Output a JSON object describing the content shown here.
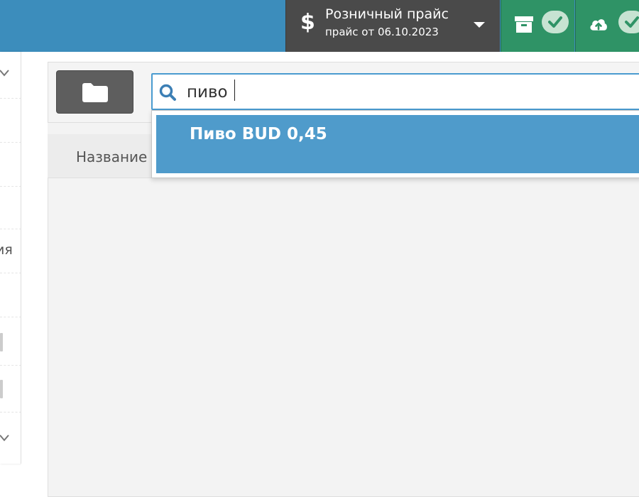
{
  "header": {
    "price_list": {
      "currency_symbol": "$",
      "title": "Розничный прайс",
      "subtitle": "прайс от 06.10.2023",
      "icon": "chevron-down-icon"
    },
    "status": [
      {
        "icon": "archive-icon",
        "state_icon": "check-icon"
      },
      {
        "icon": "cloud-upload-icon",
        "state_icon": "check-icon"
      }
    ],
    "colors": {
      "topbar": "#3c8dbc",
      "price_selector": "#4a4a4a",
      "status_ok": "#2f9366",
      "selection": "#4f9bcb"
    }
  },
  "sidebar": {
    "partial_text": "ия"
  },
  "toolbar": {
    "folder_icon": "folder-icon"
  },
  "search": {
    "value": "пиво",
    "icon": "search-icon",
    "suggestions": [
      "Пиво BUD 0,45"
    ]
  },
  "table": {
    "columns": [
      "Название"
    ]
  }
}
